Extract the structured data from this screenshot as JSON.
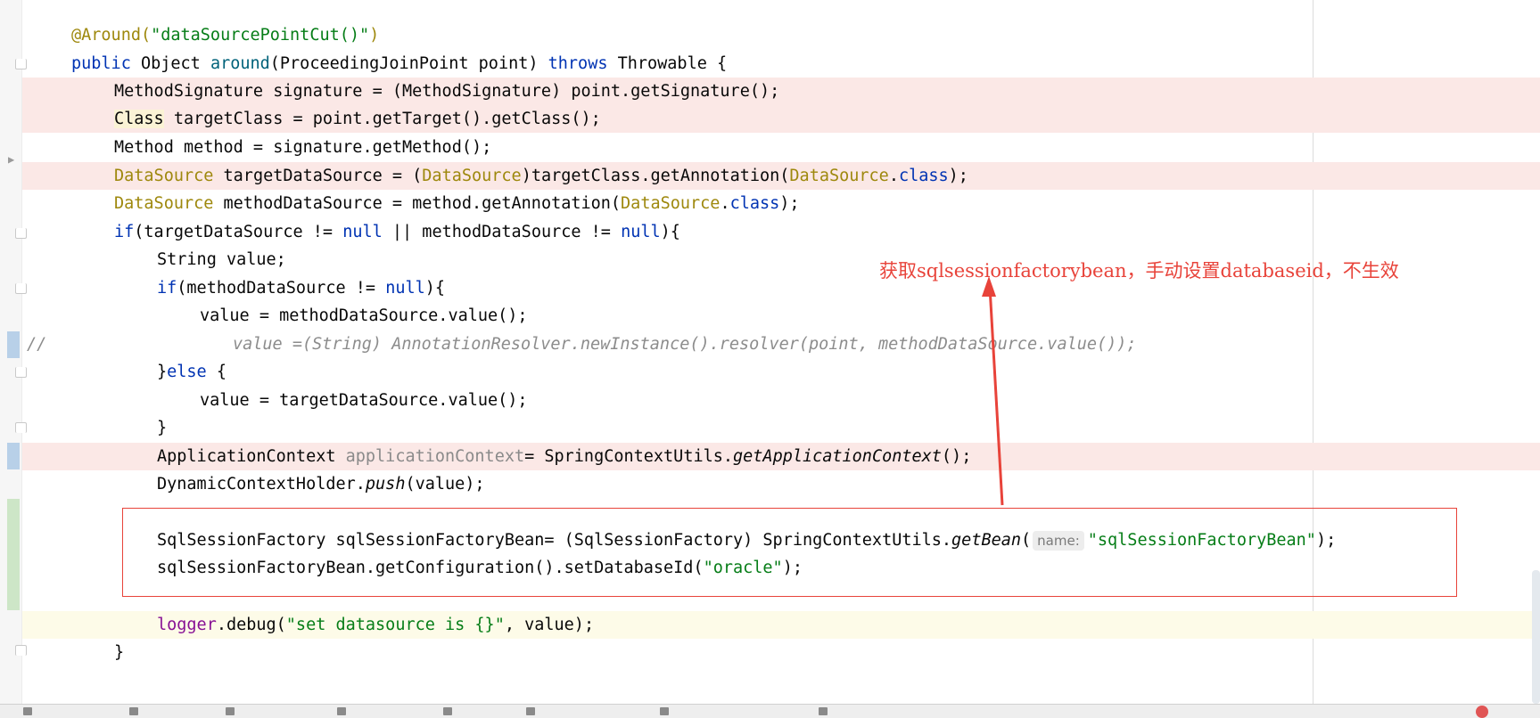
{
  "editor": {
    "lines": {
      "l1_ann": "@Around(",
      "l1_str": "\"dataSourcePointCut()\"",
      "l1_end": ")",
      "l2_public": "public ",
      "l2_obj": "Object ",
      "l2_around": "around",
      "l2_mid": "(ProceedingJoinPoint point) ",
      "l2_throws": "throws ",
      "l2_end": "Throwable {",
      "l3": "MethodSignature signature = (MethodSignature) point.getSignature();",
      "l4_class": "Class",
      "l4_rest": " targetClass = point.getTarget().getClass();",
      "l5": "Method method = signature.getMethod();",
      "l6_ds1": "DataSource",
      "l6_a": " targetDataSource = (",
      "l6_ds2": "DataSource",
      "l6_b": ")targetClass.getAnnotation(",
      "l6_ds3": "DataSource",
      "l6_dot": ".",
      "l6_class": "class",
      "l6_end": ");",
      "l7_ds1": "DataSource",
      "l7_a": " methodDataSource = method.getAnnotation(",
      "l7_ds2": "DataSource",
      "l7_dot": ".",
      "l7_class": "class",
      "l7_end": ");",
      "l8_if": "if",
      "l8_a": "(targetDataSource != ",
      "l8_null1": "null",
      "l8_b": " || methodDataSource != ",
      "l8_null2": "null",
      "l8_end": "){",
      "l9": "String value;",
      "l10_if": "if",
      "l10_a": "(methodDataSource != ",
      "l10_null": "null",
      "l10_end": "){",
      "l11": "value = methodDataSource.value();",
      "l12_prefix": "//",
      "l12_body": "value =(String) AnnotationResolver.newInstance().resolver(point, methodDataSource.value());",
      "l13_a": "}",
      "l13_else": "else",
      "l13_b": " {",
      "l14": "value = targetDataSource.value();",
      "l15": "}",
      "l16_a": "ApplicationContext ",
      "l16_var": "applicationContext",
      "l16_b": "= SpringContextUtils.",
      "l16_it": "getApplicationContext",
      "l16_end": "();",
      "l17_a": "DynamicContextHolder.",
      "l17_it": "push",
      "l17_end": "(value);",
      "l19_a": "SqlSessionFactory sqlSessionFactoryBean= (SqlSessionFactory) SpringContextUtils.",
      "l19_it": "getBean",
      "l19_open": "(",
      "l19_hint": "name:",
      "l19_str": "\"sqlSessionFactoryBean\"",
      "l19_end": ");",
      "l20_a": "sqlSessionFactoryBean.getConfiguration().setDatabaseId(",
      "l20_str": "\"oracle\"",
      "l20_end": ");",
      "l22_fld": "logger",
      "l22_a": ".debug(",
      "l22_str": "\"set datasource is {}\"",
      "l22_end": ", value);",
      "l23": "}"
    }
  },
  "annotation": {
    "note": "获取sqlsessionfactorybean，手动设置databaseid，不生效",
    "color": "#e8433a"
  }
}
